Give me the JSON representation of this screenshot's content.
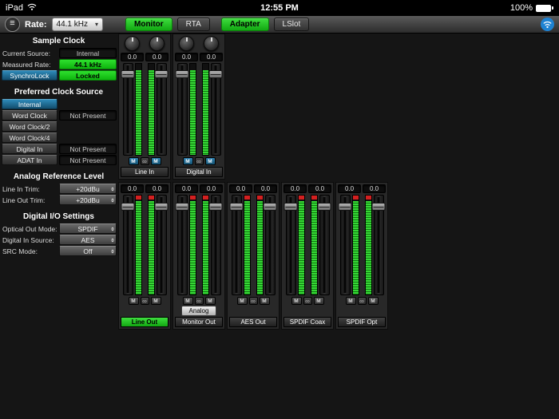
{
  "status": {
    "device": "iPad",
    "time": "12:55 PM",
    "battery": "100%"
  },
  "toolbar": {
    "rate_label": "Rate:",
    "rate_value": "44.1 kHz",
    "tabs": [
      {
        "label": "Monitor",
        "active": true
      },
      {
        "label": "RTA",
        "active": false
      },
      {
        "label": "Adapter",
        "active": true
      },
      {
        "label": "LSlot",
        "active": false
      }
    ]
  },
  "icons": {
    "menu": "≡",
    "dropdown_arrow": "▾",
    "stereo_link": "∞"
  },
  "colors": {
    "accent_green": "#2ee02e",
    "accent_blue": "#1f6f98",
    "meter_green": "#35d835",
    "clip_red": "#d42020"
  },
  "left_sections": [
    {
      "title": "Sample Clock",
      "rows": [
        {
          "label": "Current Source:",
          "label_style": "plain",
          "value": "Internal",
          "value_style": "inset"
        },
        {
          "label": "Measured Rate:",
          "label_style": "plain",
          "value": "44.1 kHz",
          "value_style": "green"
        },
        {
          "label": "SynchroLock",
          "label_style": "blue-button",
          "value": "Locked",
          "value_style": "green"
        }
      ]
    },
    {
      "title": "Preferred Clock Source",
      "rows": [
        {
          "label": "Internal",
          "label_style": "selected",
          "value": "",
          "value_style": "none"
        },
        {
          "label": "Word Clock",
          "label_style": "button",
          "value": "Not Present",
          "value_style": "inset"
        },
        {
          "label": "Word Clock/2",
          "label_style": "button",
          "value": "",
          "value_style": "none"
        },
        {
          "label": "Word Clock/4",
          "label_style": "button",
          "value": "",
          "value_style": "none"
        },
        {
          "label": "Digital In",
          "label_style": "button",
          "value": "Not Present",
          "value_style": "inset"
        },
        {
          "label": "ADAT In",
          "label_style": "button",
          "value": "Not Present",
          "value_style": "inset"
        }
      ]
    },
    {
      "title": "Analog Reference Level",
      "rows": [
        {
          "label": "Line In Trim:",
          "label_style": "plain",
          "value": "+20dBu",
          "value_style": "dropdown"
        },
        {
          "label": "Line Out Trim:",
          "label_style": "plain",
          "value": "+20dBu",
          "value_style": "dropdown"
        }
      ]
    },
    {
      "title": "Digital I/O Settings",
      "rows": [
        {
          "label": "Optical Out Mode:",
          "label_style": "plain",
          "value": "SPDIF",
          "value_style": "dropdown"
        },
        {
          "label": "Digital In Source:",
          "label_style": "plain",
          "value": "AES",
          "value_style": "dropdown"
        },
        {
          "label": "SRC Mode:",
          "label_style": "plain",
          "value": "Off",
          "value_style": "dropdown"
        }
      ]
    }
  ],
  "mixer": {
    "mute_label": "M",
    "input_groups": [
      {
        "label": "Line In",
        "active": false,
        "mutes_active": true,
        "values": [
          "0.0",
          "0.0"
        ]
      },
      {
        "label": "Digital In",
        "active": false,
        "mutes_active": true,
        "values": [
          "0.0",
          "0.0"
        ]
      }
    ],
    "output_groups": [
      {
        "label": "Line Out",
        "active": true,
        "mutes_active": false,
        "values": [
          "0.0",
          "0.0"
        ]
      },
      {
        "label": "Monitor Out",
        "active": false,
        "mutes_active": false,
        "sublabel": "Analog",
        "values": [
          "0.0",
          "0.0"
        ]
      },
      {
        "label": "AES Out",
        "active": false,
        "mutes_active": false,
        "values": [
          "0.0",
          "0.0"
        ]
      },
      {
        "label": "SPDIF Coax",
        "active": false,
        "mutes_active": false,
        "values": [
          "0.0",
          "0.0"
        ]
      },
      {
        "label": "SPDIF Opt",
        "active": false,
        "mutes_active": false,
        "values": [
          "0.0",
          "0.0"
        ]
      }
    ]
  }
}
